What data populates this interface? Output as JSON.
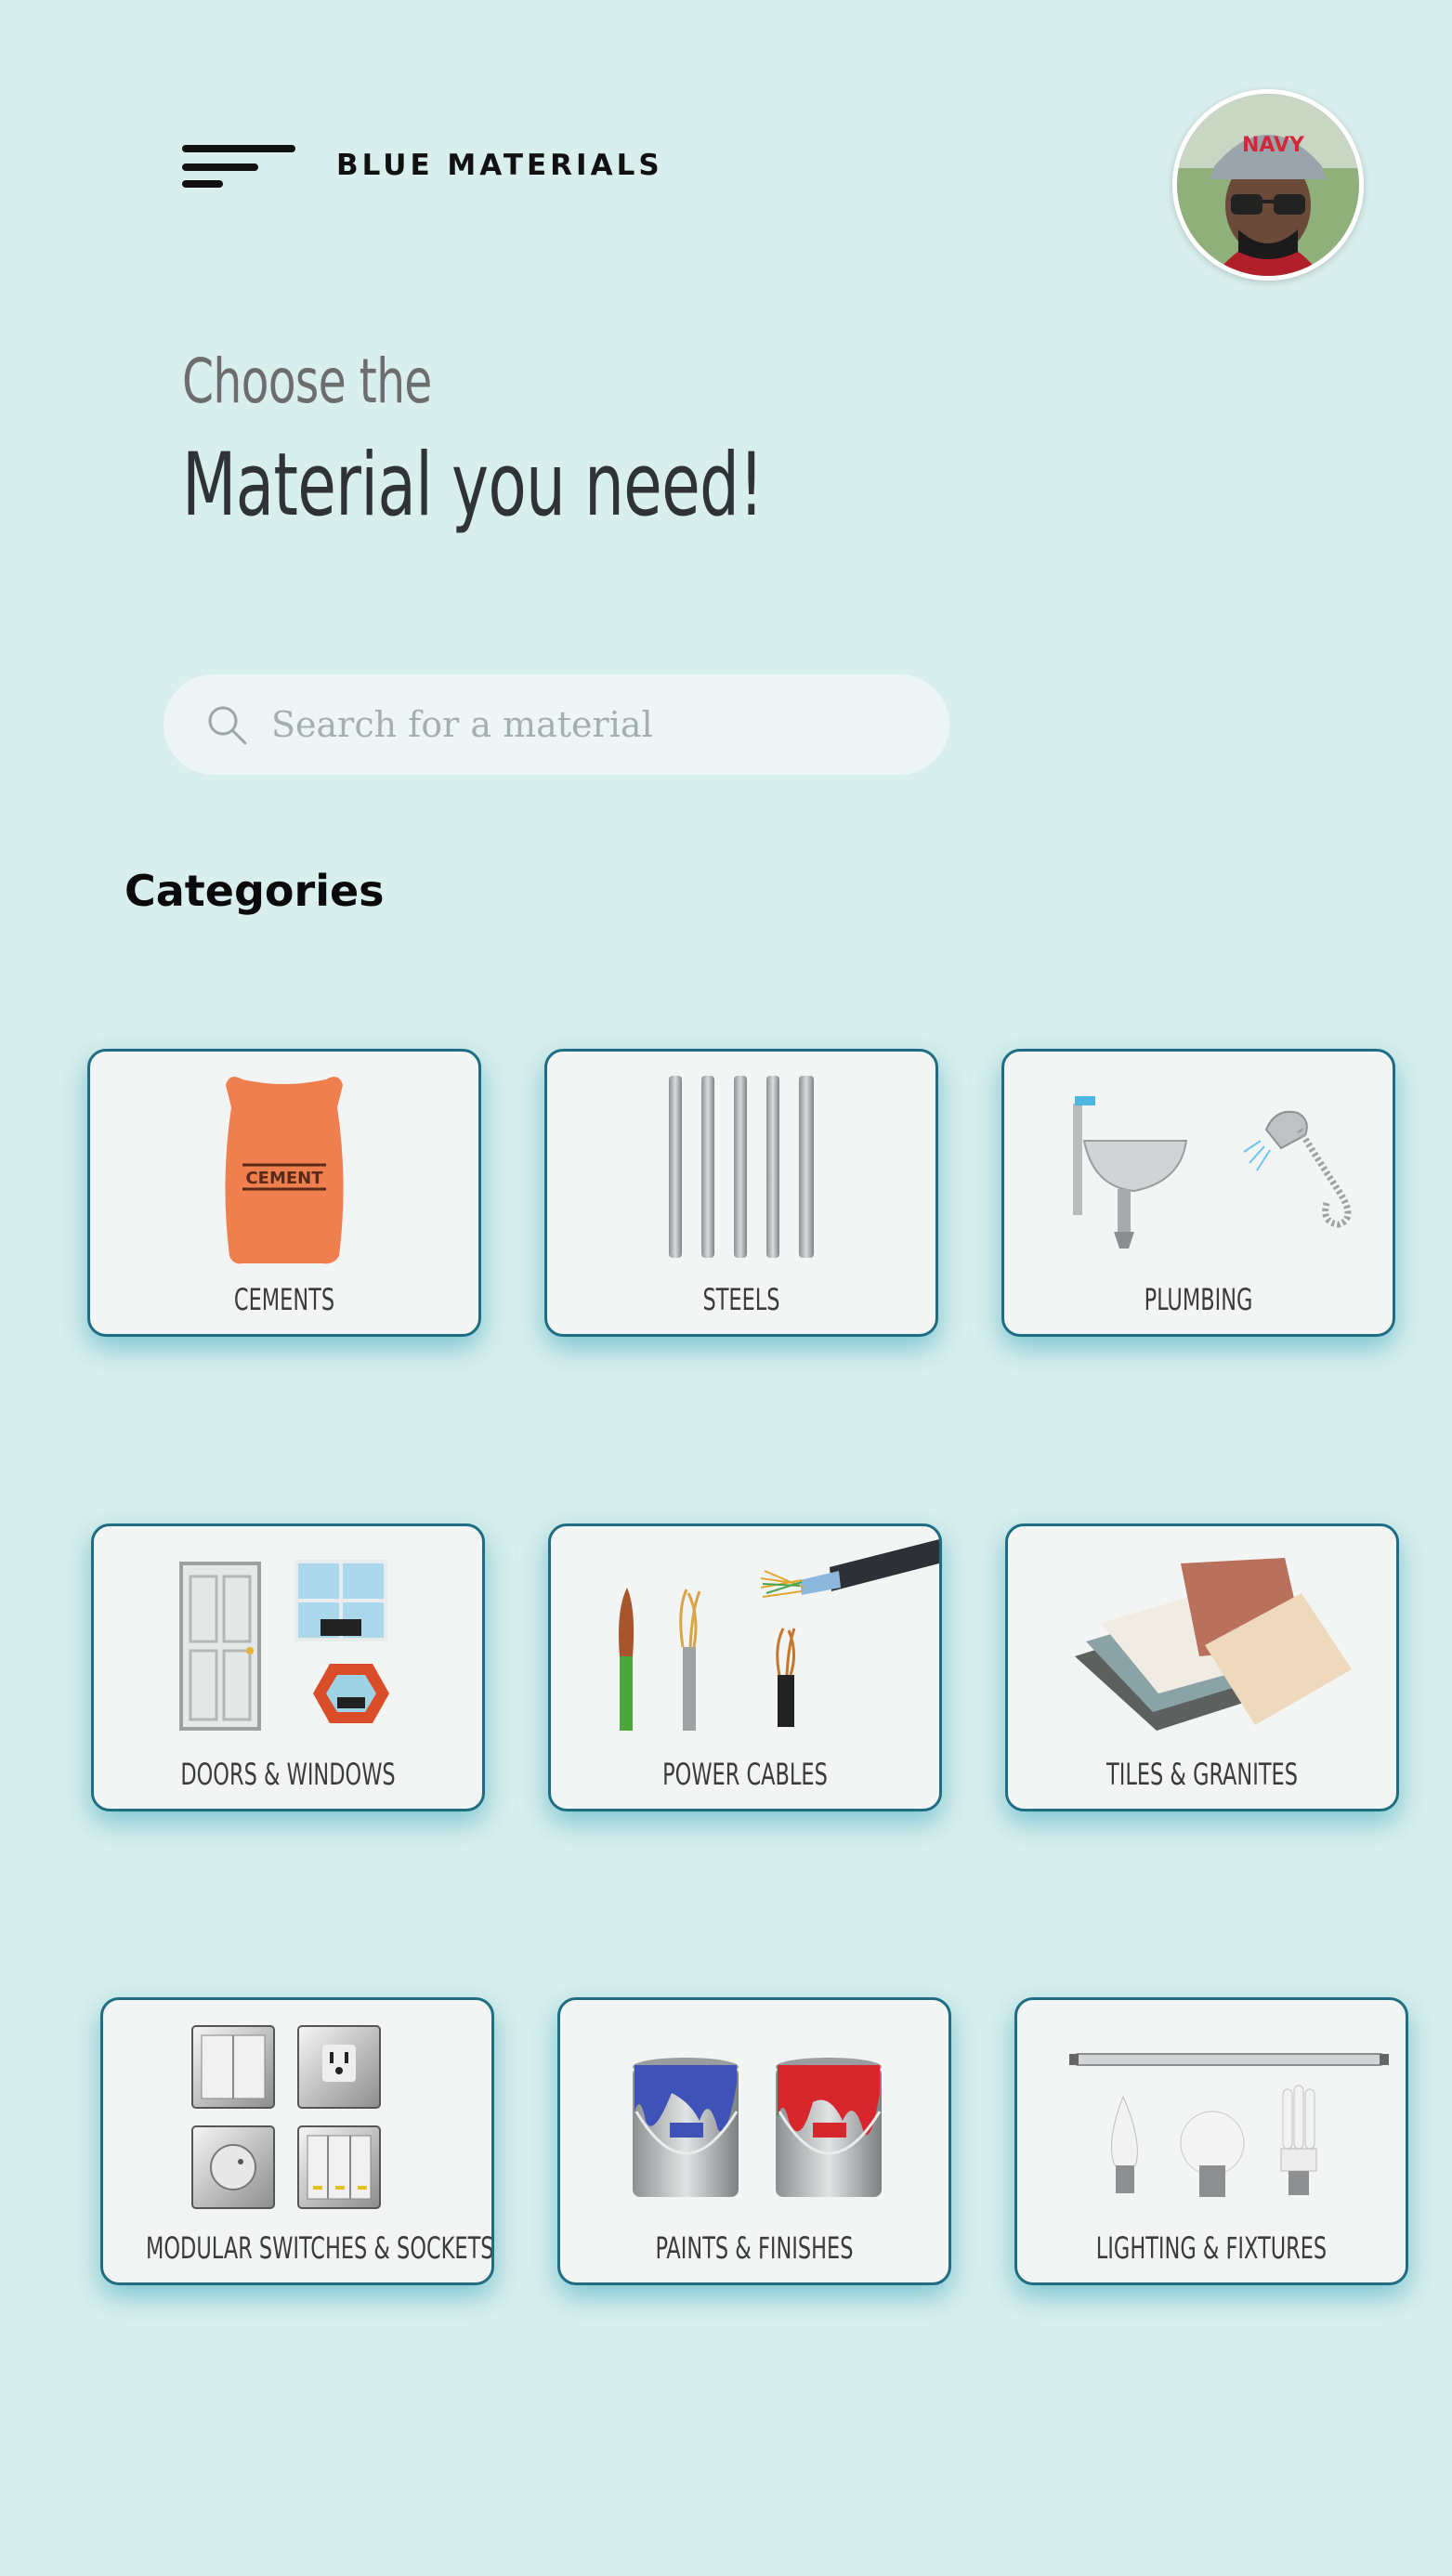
{
  "app": {
    "brand": "BLUE MATERIALS"
  },
  "header": {
    "menu_icon": "hamburger-menu-icon",
    "avatar_icon": "user-avatar"
  },
  "hero": {
    "line1": "Choose the",
    "line2": "Material you need!"
  },
  "search": {
    "placeholder": "Search for a material",
    "value": "",
    "icon": "search-icon"
  },
  "categories": {
    "title": "Categories",
    "items": [
      {
        "label": "CEMENTS",
        "icon": "cement-bag-icon"
      },
      {
        "label": "STEELS",
        "icon": "steel-rods-icon"
      },
      {
        "label": "PLUMBING",
        "icon": "sink-shower-icon"
      },
      {
        "label": "DOORS & WINDOWS",
        "icon": "door-window-icon"
      },
      {
        "label": "POWER CABLES",
        "icon": "cables-icon"
      },
      {
        "label": "TILES & GRANITES",
        "icon": "tiles-icon"
      },
      {
        "label": "MODULAR SWITCHES & SOCKETS",
        "icon": "switches-sockets-icon"
      },
      {
        "label": "PAINTS & FINISHES",
        "icon": "paint-cans-icon"
      },
      {
        "label": "LIGHTING & FIXTURES",
        "icon": "light-bulbs-icon"
      }
    ]
  },
  "colors": {
    "background": "#d9efed",
    "card_border": "#1e6d83",
    "card_bg": "#f3f4f4",
    "search_bg": "#edf6f5"
  }
}
